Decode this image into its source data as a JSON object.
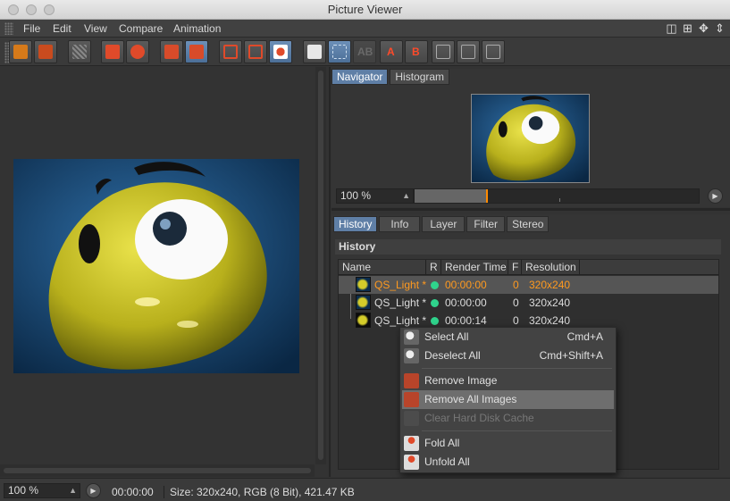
{
  "window": {
    "title": "Picture Viewer"
  },
  "menu": [
    "File",
    "Edit",
    "View",
    "Compare",
    "Animation"
  ],
  "toolbar": {
    "buttons": [
      "open-icon",
      "save-icon",
      "grid-icon",
      "render-to-pv-icon",
      "render-user-icon",
      "remove-icon",
      "remove-all-icon",
      "view-a-icon",
      "view-b-icon",
      "view-ab-icon",
      "ab-compare-icon",
      "ab-split-icon",
      "ab-disabled-icon",
      "set-a-icon",
      "set-b-icon",
      "compare-1-icon",
      "compare-2-icon",
      "compare-3-icon"
    ],
    "labels": {
      "ab": "AB",
      "a": "A",
      "b": "B"
    }
  },
  "navigator": {
    "tabs": [
      "Navigator",
      "Histogram"
    ],
    "active_tab": "Navigator",
    "zoom": "100 %",
    "timeline_position": 0.25
  },
  "history_panel": {
    "tabs": [
      "History",
      "Info",
      "Layer",
      "Filter",
      "Stereo"
    ],
    "active_tab": "History",
    "section_title": "History",
    "columns": [
      "Name",
      "R",
      "Render Time",
      "F",
      "Resolution"
    ],
    "rows": [
      {
        "name": "QS_Light *",
        "time": "00:00:00",
        "frame": "0",
        "resolution": "320x240",
        "selected": true
      },
      {
        "name": "QS_Light *",
        "time": "00:00:00",
        "frame": "0",
        "resolution": "320x240",
        "selected": false
      },
      {
        "name": "QS_Light *",
        "time": "00:00:14",
        "frame": "0",
        "resolution": "320x240",
        "selected": false
      }
    ]
  },
  "context_menu": {
    "items": [
      {
        "label": "Select All",
        "shortcut": "Cmd+A",
        "icon": "select-all-icon"
      },
      {
        "label": "Deselect All",
        "shortcut": "Cmd+Shift+A",
        "icon": "deselect-all-icon"
      },
      {
        "label": "Remove Image",
        "shortcut": "",
        "icon": "remove-image-icon"
      },
      {
        "label": "Remove All Images",
        "shortcut": "",
        "icon": "remove-all-images-icon",
        "highlighted": true
      },
      {
        "label": "Clear Hard Disk Cache",
        "shortcut": "",
        "icon": "clear-cache-icon",
        "disabled": true
      },
      {
        "label": "Fold All",
        "shortcut": "",
        "icon": "fold-all-icon"
      },
      {
        "label": "Unfold All",
        "shortcut": "",
        "icon": "unfold-all-icon"
      }
    ]
  },
  "status": {
    "zoom": "100 %",
    "time": "00:00:00",
    "info": "Size: 320x240, RGB (8 Bit), 421.47 KB"
  },
  "colors": {
    "accent_tab": "#5f7fa6",
    "selected_row_text": "#ff9a1f",
    "status_dot": "#2fd38c",
    "timeline_marker": "#ff8a00"
  }
}
